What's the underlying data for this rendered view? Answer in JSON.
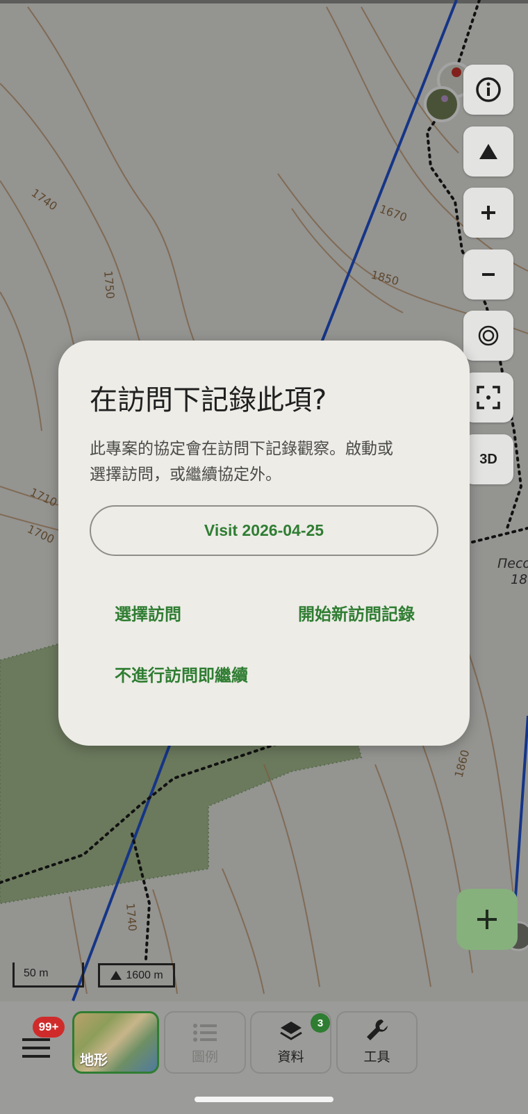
{
  "map": {
    "contour_labels": [
      "1740",
      "1750",
      "1670",
      "1850",
      "1710",
      "1700",
      "1740",
      "1860"
    ],
    "place_label_line1": "Песо",
    "place_label_line2": "18",
    "scale_label": "50 m",
    "elevation_label": "1600 m",
    "colors": {
      "land": "#d6d6d2",
      "forest": "#9eb38a",
      "contour": "#b48a60",
      "ski_lift": "#1f4fc8",
      "trail": "#1a1a1a"
    }
  },
  "controls": {
    "info": "info-icon",
    "north": "triangle-up-icon",
    "zoom_in": "plus-icon",
    "zoom_out": "minus-icon",
    "locate": "target-icon",
    "focus": "focus-frame-icon",
    "three_d_label": "3D",
    "add": "plus-icon"
  },
  "bottom_bar": {
    "menu_badge": "99+",
    "basemap_label": "地形",
    "legend_label": "圖例",
    "data_label": "資料",
    "data_badge": "3",
    "tools_label": "工具"
  },
  "dialog": {
    "title": "在訪問下記錄此項?",
    "body_line1": "此專案的協定會在訪問下記錄觀察。啟動或",
    "body_line2": "選擇訪問，或繼續協定外。",
    "visit_button": "Visit 2026-04-25",
    "choose_visit": "選擇訪問",
    "start_new_visit": "開始新訪問記錄",
    "continue_without_visit": "不進行訪問即繼續",
    "accent_color": "#2f7d32"
  }
}
